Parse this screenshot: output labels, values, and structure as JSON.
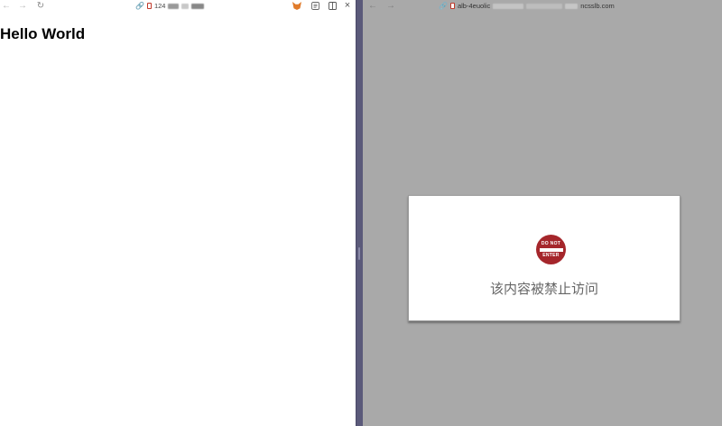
{
  "left_pane": {
    "toolbar": {
      "back_icon": "arrow-left-icon",
      "forward_icon": "arrow-right-icon",
      "reload_icon": "reload-icon",
      "url_prefix": "124",
      "link_icon": "link-icon",
      "extension_icon": "fox-extension-icon",
      "reader_icon": "reader-icon",
      "split_icon": "split-view-icon",
      "close_icon": "close-icon"
    },
    "content": {
      "heading": "Hello World"
    }
  },
  "right_pane": {
    "toolbar": {
      "back_icon": "arrow-left-icon",
      "forward_icon": "arrow-right-icon",
      "url_start": "alb-4euolic",
      "url_end": "ncsslb.com",
      "link_icon": "link-icon"
    },
    "error": {
      "sign_top": "DO NOT",
      "sign_bottom": "ENTER",
      "message": "该内容被禁止访问"
    }
  },
  "colors": {
    "right_background": "#a9a9a9",
    "divider": "#5b5a7a",
    "sign_red": "#a5262b",
    "message_gray": "#666666"
  }
}
